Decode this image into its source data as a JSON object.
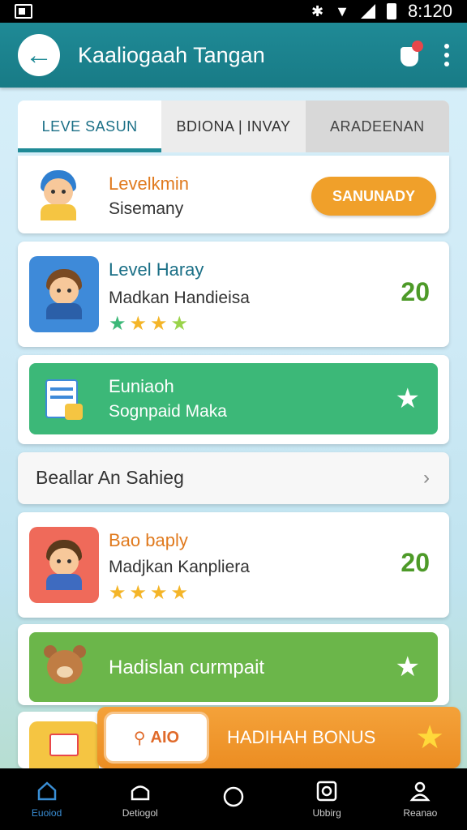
{
  "status_bar": {
    "time": "8:120"
  },
  "app_bar": {
    "title": "Kaaliogaah Tangan"
  },
  "tabs": [
    {
      "label": "LEVE SASUN"
    },
    {
      "label": "BDIONA | INVAY"
    },
    {
      "label": "ARADEENAN"
    }
  ],
  "cards": {
    "profile": {
      "title": "Levelkmin",
      "subtitle": "Sisemany",
      "button": "SANUNADY"
    },
    "level_1": {
      "title": "Level Haray",
      "subtitle": "Madkan Handieisa",
      "score": "20",
      "stars": 4
    },
    "achievement": {
      "title": "Euniaoh",
      "subtitle": "Sognpaid Maka"
    },
    "list_row": {
      "label": "Beallar An Sahieg"
    },
    "level_2": {
      "title": "Bao baply",
      "subtitle": "Madjkan Kanpliera",
      "score": "20",
      "stars": 4
    },
    "reward": {
      "title": "Hadislan curmpait"
    },
    "bonus": {
      "pill": "AIO",
      "label": "HADIHAH BONUS"
    }
  },
  "bottom_nav": [
    {
      "label": "Euoiod",
      "icon": "home-icon"
    },
    {
      "label": "Detiogol",
      "icon": "house-outline-icon"
    },
    {
      "label": "",
      "icon": "circle-icon"
    },
    {
      "label": "Ubbirg",
      "icon": "camera-icon"
    },
    {
      "label": "Reanao",
      "icon": "person-icon"
    }
  ],
  "colors": {
    "appbar": "#1f8a96",
    "accent_orange": "#f0a02a",
    "green_panel": "#3cb878",
    "green_panel_2": "#6bb64a",
    "score_green": "#4d9a28"
  }
}
